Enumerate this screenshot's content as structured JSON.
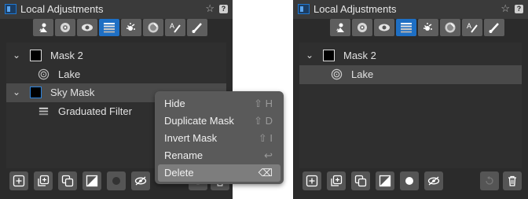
{
  "left_panel": {
    "title": "Local Adjustments",
    "star": "☆",
    "help": "?",
    "tools": [
      {
        "icon": "people-mask-icon",
        "active": false
      },
      {
        "icon": "radial-target-icon",
        "active": false
      },
      {
        "icon": "eye-icon",
        "active": false
      },
      {
        "icon": "gradient-icon",
        "active": true
      },
      {
        "icon": "sun-burst-icon",
        "active": false
      },
      {
        "icon": "lens-icon",
        "active": false
      },
      {
        "icon": "text-brush-icon",
        "active": false
      },
      {
        "icon": "brush-icon",
        "active": false
      }
    ],
    "mask2": {
      "label": "Mask 2",
      "chevron": "⌄"
    },
    "lake": {
      "label": "Lake"
    },
    "sky": {
      "label": "Sky Mask",
      "chevron": "⌄"
    },
    "grad": {
      "label": "Graduated Filter"
    },
    "context_menu": {
      "hide": {
        "label": "Hide",
        "shortcut": "⇧ H"
      },
      "duplicate": {
        "label": "Duplicate Mask",
        "shortcut": "⇧ D"
      },
      "invert": {
        "label": "Invert Mask",
        "shortcut": "⇧ I"
      },
      "rename": {
        "label": "Rename",
        "shortcut": "↩"
      },
      "delete": {
        "label": "Delete",
        "shortcut": "⌫"
      }
    }
  },
  "right_panel": {
    "title": "Local Adjustments",
    "star": "☆",
    "help": "?",
    "mask2": {
      "label": "Mask 2",
      "chevron": "⌄"
    },
    "lake": {
      "label": "Lake"
    }
  },
  "colors": {
    "panel_bg": "#2b2b2b",
    "accent": "#1e6fc4",
    "selected_row": "#4a4a4a"
  }
}
